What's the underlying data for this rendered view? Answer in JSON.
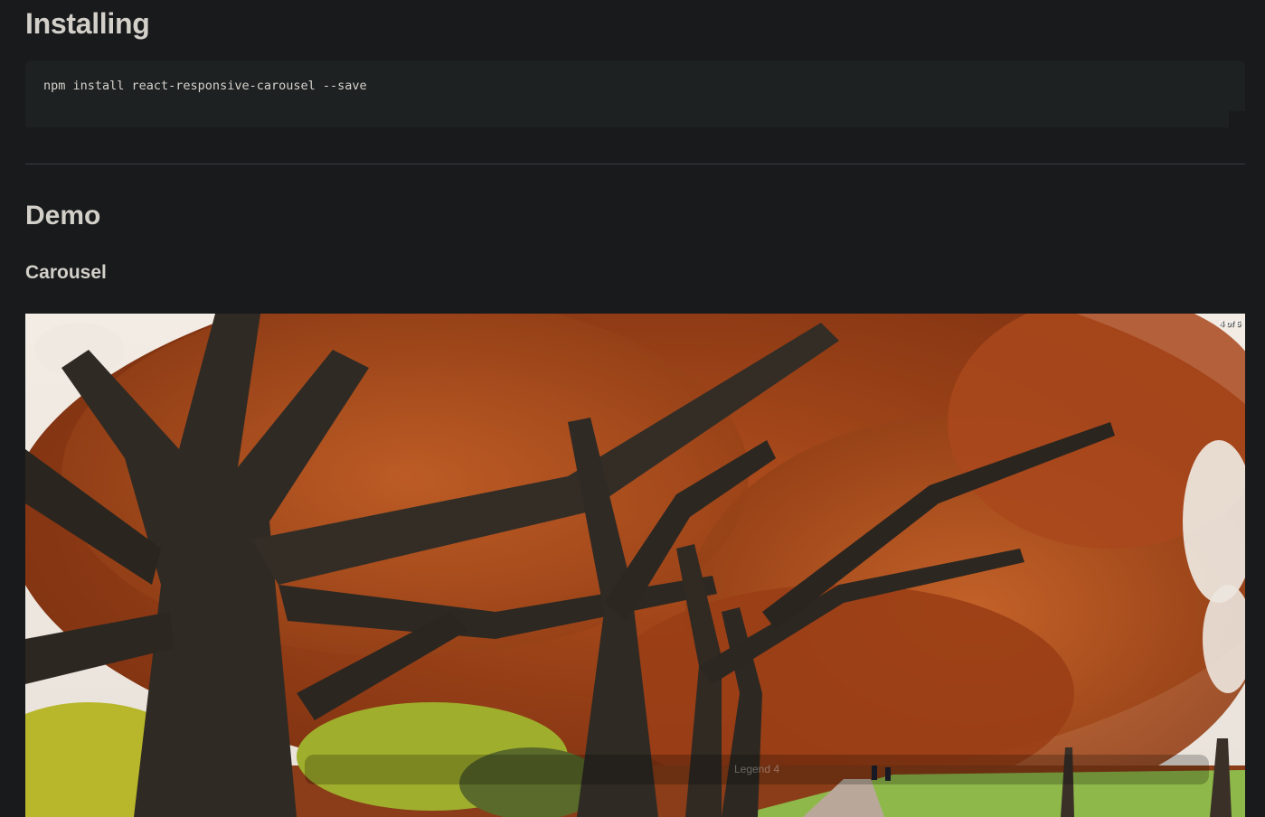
{
  "installing": {
    "heading": "Installing",
    "command": "npm install react-responsive-carousel --save"
  },
  "demo": {
    "heading": "Demo",
    "subheading": "Carousel"
  },
  "carousel": {
    "status": "4 of 6",
    "legend": "Legend 4"
  }
}
